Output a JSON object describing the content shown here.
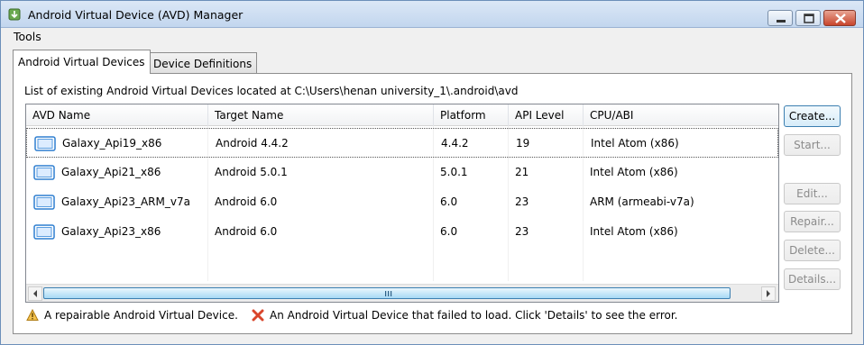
{
  "window": {
    "title": "Android Virtual Device (AVD) Manager",
    "app_icon": "android-download-icon"
  },
  "menubar": {
    "items": [
      "Tools"
    ]
  },
  "tabs": [
    {
      "label": "Android Virtual Devices",
      "active": true
    },
    {
      "label": "Device Definitions",
      "active": false
    }
  ],
  "panel": {
    "description": "List of existing Android Virtual Devices located at C:\\Users\\henan university_1\\.android\\avd"
  },
  "table": {
    "columns": [
      "AVD Name",
      "Target Name",
      "Platform",
      "API Level",
      "CPU/ABI"
    ],
    "rows": [
      {
        "name": "Galaxy_Api19_x86",
        "target": "Android 4.4.2",
        "platform": "4.4.2",
        "api": "19",
        "cpu": "Intel Atom (x86)",
        "selected": true
      },
      {
        "name": "Galaxy_Api21_x86",
        "target": "Android 5.0.1",
        "platform": "5.0.1",
        "api": "21",
        "cpu": "Intel Atom (x86)",
        "selected": false
      },
      {
        "name": "Galaxy_Api23_ARM_v7a",
        "target": "Android 6.0",
        "platform": "6.0",
        "api": "23",
        "cpu": "ARM (armeabi-v7a)",
        "selected": false
      },
      {
        "name": "Galaxy_Api23_x86",
        "target": "Android 6.0",
        "platform": "6.0",
        "api": "23",
        "cpu": "Intel Atom (x86)",
        "selected": false
      }
    ],
    "row_icon": "device-icon"
  },
  "buttons": {
    "create": "Create...",
    "start": "Start...",
    "edit": "Edit...",
    "repair": "Repair...",
    "delete": "Delete...",
    "details": "Details..."
  },
  "legend": {
    "repairable": "A repairable Android Virtual Device.",
    "failed": "An Android Virtual Device that failed to load. Click 'Details' to see the error."
  },
  "colors": {
    "selection_border": "#555555",
    "scroll_thumb": "#a7d9f5",
    "close_button": "#c8452c",
    "warning": "#e8b23c",
    "error": "#d9452b"
  }
}
